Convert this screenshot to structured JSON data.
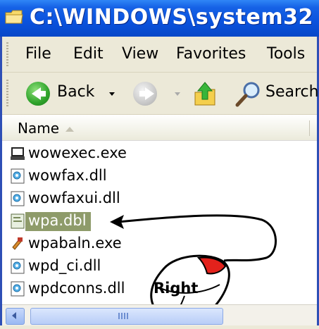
{
  "window": {
    "title": "C:\\WINDOWS\\system32",
    "title_bar_color": "#0a52dd",
    "title_icon": "folder-icon"
  },
  "menu": {
    "items": [
      "File",
      "Edit",
      "View",
      "Favorites",
      "Tools"
    ]
  },
  "toolbar": {
    "back_label": "Back",
    "search_label": "Search",
    "icons": [
      "back-arrow-icon",
      "forward-arrow-icon",
      "up-folder-icon",
      "search-magnifier-icon"
    ]
  },
  "columns": {
    "name_header": "Name",
    "sort": "ascending"
  },
  "files": [
    {
      "name": "wowexec.exe",
      "icon": "exe-computer-icon",
      "selected": false
    },
    {
      "name": "wowfax.dll",
      "icon": "dll-icon",
      "selected": false
    },
    {
      "name": "wowfaxui.dll",
      "icon": "dll-icon",
      "selected": false
    },
    {
      "name": "wpa.dbl",
      "icon": "generic-file-icon",
      "selected": true
    },
    {
      "name": "wpabaln.exe",
      "icon": "wpa-tool-icon",
      "selected": false
    },
    {
      "name": "wpd_ci.dll",
      "icon": "dll-icon",
      "selected": false
    },
    {
      "name": "wpdconns.dll",
      "icon": "dll-icon",
      "selected": false
    }
  ],
  "selection_color": "#8e9b6a",
  "annotation": {
    "mouse_label": "Right",
    "mouse_button_highlight": "#e3221c"
  }
}
